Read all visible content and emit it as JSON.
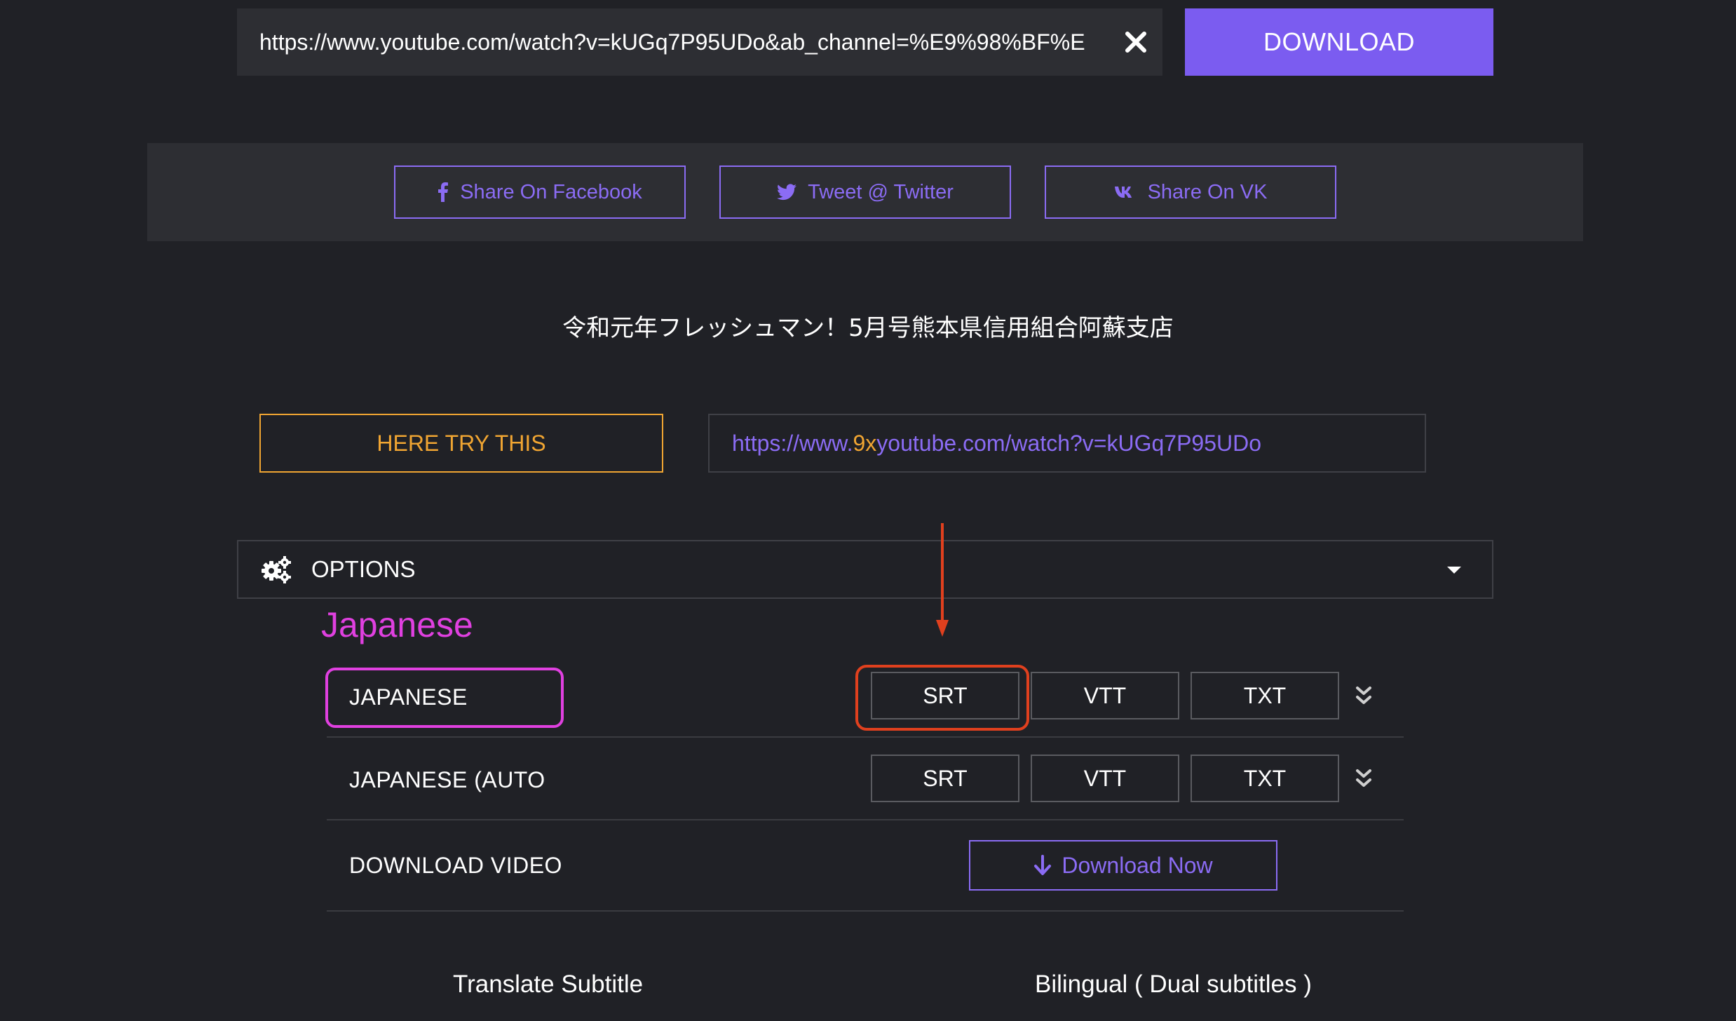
{
  "url_input": {
    "value": "https://www.youtube.com/watch?v=kUGq7P95UDo&ab_channel=%E9%98%BF%E"
  },
  "download_button": "DOWNLOAD",
  "share": {
    "facebook": "Share On Facebook",
    "twitter": "Tweet @ Twitter",
    "vk": "Share On VK"
  },
  "video_title": "令和元年フレッシュマン！5月号熊本県信用組合阿蘇支店",
  "try_button": "HERE TRY THIS",
  "alt_link": {
    "prefix": "https://www.",
    "highlight": "9x",
    "suffix": "youtube.com/watch?v=kUGq7P95UDo"
  },
  "options_label": "OPTIONS",
  "language_heading": "Japanese",
  "subtitle_rows": [
    {
      "label": "JAPANESE",
      "formats": [
        "SRT",
        "VTT",
        "TXT"
      ]
    },
    {
      "label": "JAPANESE (AUTO",
      "formats": [
        "SRT",
        "VTT",
        "TXT"
      ]
    }
  ],
  "download_video": {
    "label": "DOWNLOAD VIDEO",
    "button": "Download Now"
  },
  "bottom": {
    "translate": "Translate Subtitle",
    "bilingual": "Bilingual ( Dual subtitles )"
  },
  "colors": {
    "background": "#202126",
    "accent_purple": "#7b5cf0",
    "accent_orange": "#f0a532",
    "annotation_magenta": "#e040e0",
    "annotation_red": "#e0401e"
  }
}
